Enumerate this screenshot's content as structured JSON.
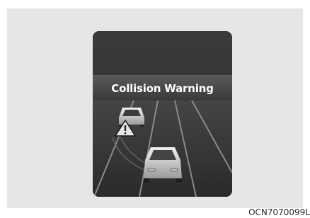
{
  "display": {
    "warning_message": "Collision Warning"
  },
  "figure": {
    "code": "OCN7070099L"
  },
  "colors": {
    "page_background": "#ffffff",
    "panel_background": "#e6e6e6",
    "display_background": "#3a3a3a",
    "warning_text": "#ffffff"
  },
  "icons": {
    "warning": "warning-triangle-icon",
    "ego_vehicle": "ego-car-icon",
    "other_vehicle": "adjacent-car-icon"
  }
}
